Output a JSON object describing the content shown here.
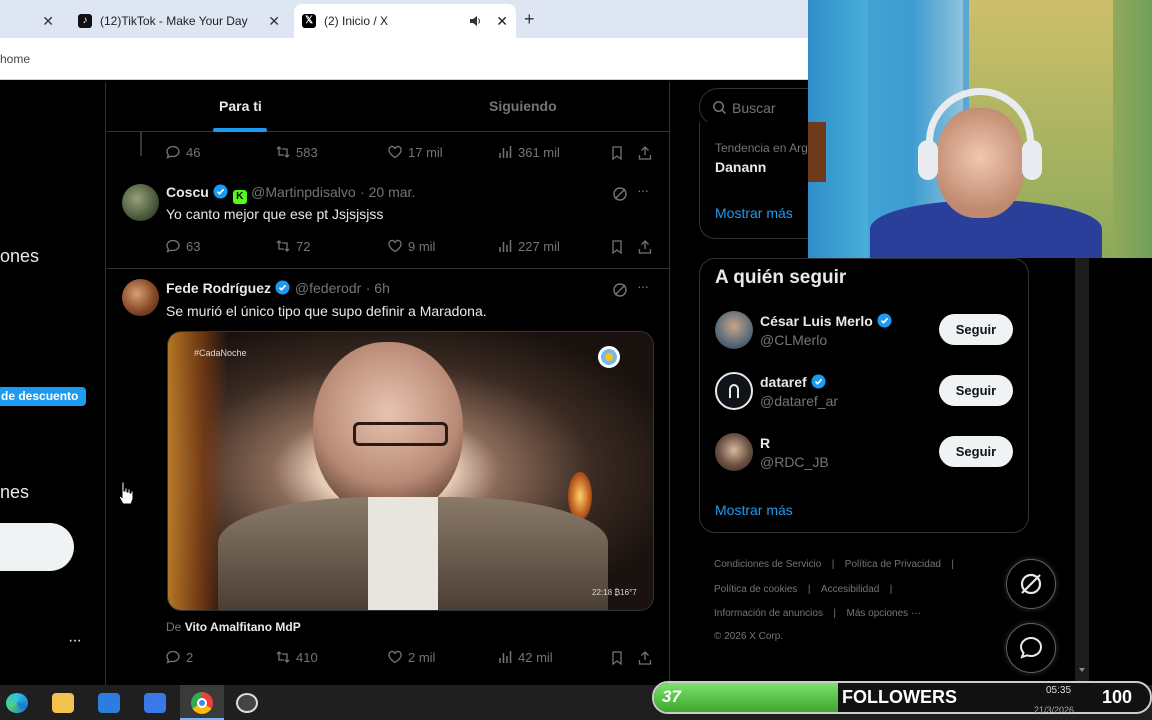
{
  "browser": {
    "tabs": [
      {
        "title": "",
        "close": "✕"
      },
      {
        "title": "(12)TikTok - Make Your Day",
        "close": "✕"
      },
      {
        "title": "(2) Inicio / X",
        "close": "✕",
        "active": true
      }
    ],
    "new_tab": "+",
    "address": "home"
  },
  "leftnav": {
    "item1": "ones",
    "promo": "de descuento",
    "item2": "nes",
    "more": "···"
  },
  "timeline": {
    "tabs": [
      "Para ti",
      "Siguiendo"
    ],
    "tweets": [
      {
        "stats": {
          "replies": "46",
          "reposts": "583",
          "likes": "17 mil",
          "views": "361 mil"
        }
      },
      {
        "name": "Coscu",
        "handle": "@Martinpdisalvo",
        "time": "· 20 mar.",
        "text": "Yo canto mejor que ese pt  Jsjsjsjss",
        "stats": {
          "replies": "63",
          "reposts": "72",
          "likes": "9 mil",
          "views": "227 mil"
        }
      },
      {
        "name": "Fede Rodríguez",
        "handle": "@federodr",
        "time": "· 6h",
        "text": "Se murió el único tipo que supo definir a Maradona.",
        "video_watermark": "#CadaNoche",
        "video_timestamp": "22:18 ₿16°7",
        "source_prefix": "De",
        "source_name": "Vito Amalfitano MdP",
        "stats": {
          "replies": "2",
          "reposts": "410",
          "likes": "2 mil",
          "views": "42 mil"
        }
      }
    ]
  },
  "right": {
    "search_placeholder": "Buscar",
    "trend_label": "Tendencia en Arg",
    "trend_name": "Danann",
    "show_more_1": "Mostrar más",
    "who_to_follow_title": "A quién seguir",
    "follow_suggestions": [
      {
        "name": "César Luis Merlo",
        "handle": "@CLMerlo",
        "button": "Seguir"
      },
      {
        "name": "dataref",
        "handle": "@dataref_ar",
        "button": "Seguir"
      },
      {
        "name": "R",
        "handle": "@RDC_JB",
        "button": "Seguir"
      }
    ],
    "show_more_2": "Mostrar más",
    "footer": {
      "terms": "Condiciones de Servicio",
      "privacy": "Política de Privacidad",
      "cookies": "Política de cookies",
      "accessibility": "Accesibilidad",
      "ads": "Información de anuncios",
      "more": "Más opciones ···",
      "copyright": "© 2026 X Corp."
    }
  },
  "overlay": {
    "follower_count": "37",
    "followers_label": "FOLLOWERS",
    "goal": "100",
    "clock_time": "05:35",
    "clock_date": "21/3/2026"
  },
  "colors": {
    "accent": "#1d9bf0",
    "progress_green": "#4cbb3c"
  }
}
